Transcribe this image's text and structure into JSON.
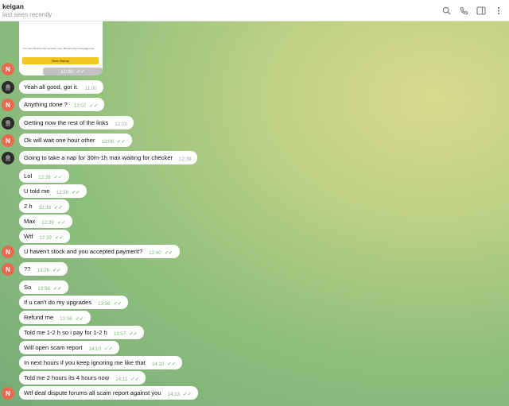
{
  "header": {
    "contact_name": "keigan",
    "status": "last seen recently",
    "icons": [
      "search-icon",
      "phone-icon",
      "sidebar-icon",
      "more-icon"
    ]
  },
  "image_card": {
    "small_text": "For more Binance Pay services, open Binance Pay homepage now.",
    "button_label": "View History",
    "time": "11:00"
  },
  "messages": [
    {
      "text": "Yeah all good, got it.",
      "time": "11:00",
      "direction": "in",
      "avatar": ""
    },
    {
      "text": "Anything done ?",
      "time": "12:07",
      "direction": "out",
      "avatar": "N"
    },
    {
      "text": "Getting now the rest of the links",
      "time": "12:08",
      "direction": "in",
      "avatar": ""
    },
    {
      "text": "Ok will wait one hour other",
      "time": "12:08",
      "direction": "out",
      "avatar": "N"
    },
    {
      "text": "Going to take a nap for 30m-1h max waiting for checker",
      "time": "12:39",
      "direction": "in",
      "avatar": ""
    },
    {
      "text": "Lol",
      "time": "12:39",
      "direction": "out",
      "avatar": ""
    },
    {
      "text": "U told me",
      "time": "12:39",
      "direction": "out",
      "avatar": ""
    },
    {
      "text": "2 h",
      "time": "12:39",
      "direction": "out",
      "avatar": ""
    },
    {
      "text": "Max",
      "time": "12:39",
      "direction": "out",
      "avatar": ""
    },
    {
      "text": "Wtf",
      "time": "12:39",
      "direction": "out",
      "avatar": ""
    },
    {
      "text": "U haven't stock and you accepted payment?",
      "time": "12:40",
      "direction": "out",
      "avatar": "N"
    },
    {
      "text": "??",
      "time": "13:26",
      "direction": "out",
      "avatar": "N"
    },
    {
      "text": "So",
      "time": "13:56",
      "direction": "out",
      "avatar": ""
    },
    {
      "text": "If u can't do my upgrades",
      "time": "13:56",
      "direction": "out",
      "avatar": ""
    },
    {
      "text": "Refund me",
      "time": "13:56",
      "direction": "out",
      "avatar": ""
    },
    {
      "text": "Told me 1-2 h so i pay for 1-2 h",
      "time": "13:57",
      "direction": "out",
      "avatar": ""
    },
    {
      "text": "Will open scam report",
      "time": "14:10",
      "direction": "out",
      "avatar": ""
    },
    {
      "text": "In next hours if you keep ignoring me like that",
      "time": "14:10",
      "direction": "out",
      "avatar": ""
    },
    {
      "text": "Told me 2 hours its 4 hours now",
      "time": "14:11",
      "direction": "out",
      "avatar": ""
    },
    {
      "text": "Wtf deal dispute forums all scam report against you",
      "time": "14:13",
      "direction": "out",
      "avatar": "N"
    }
  ],
  "colors": {
    "accent": "#5ead59",
    "avatar_n": "#e9694f",
    "bubble": "#ffffff"
  }
}
